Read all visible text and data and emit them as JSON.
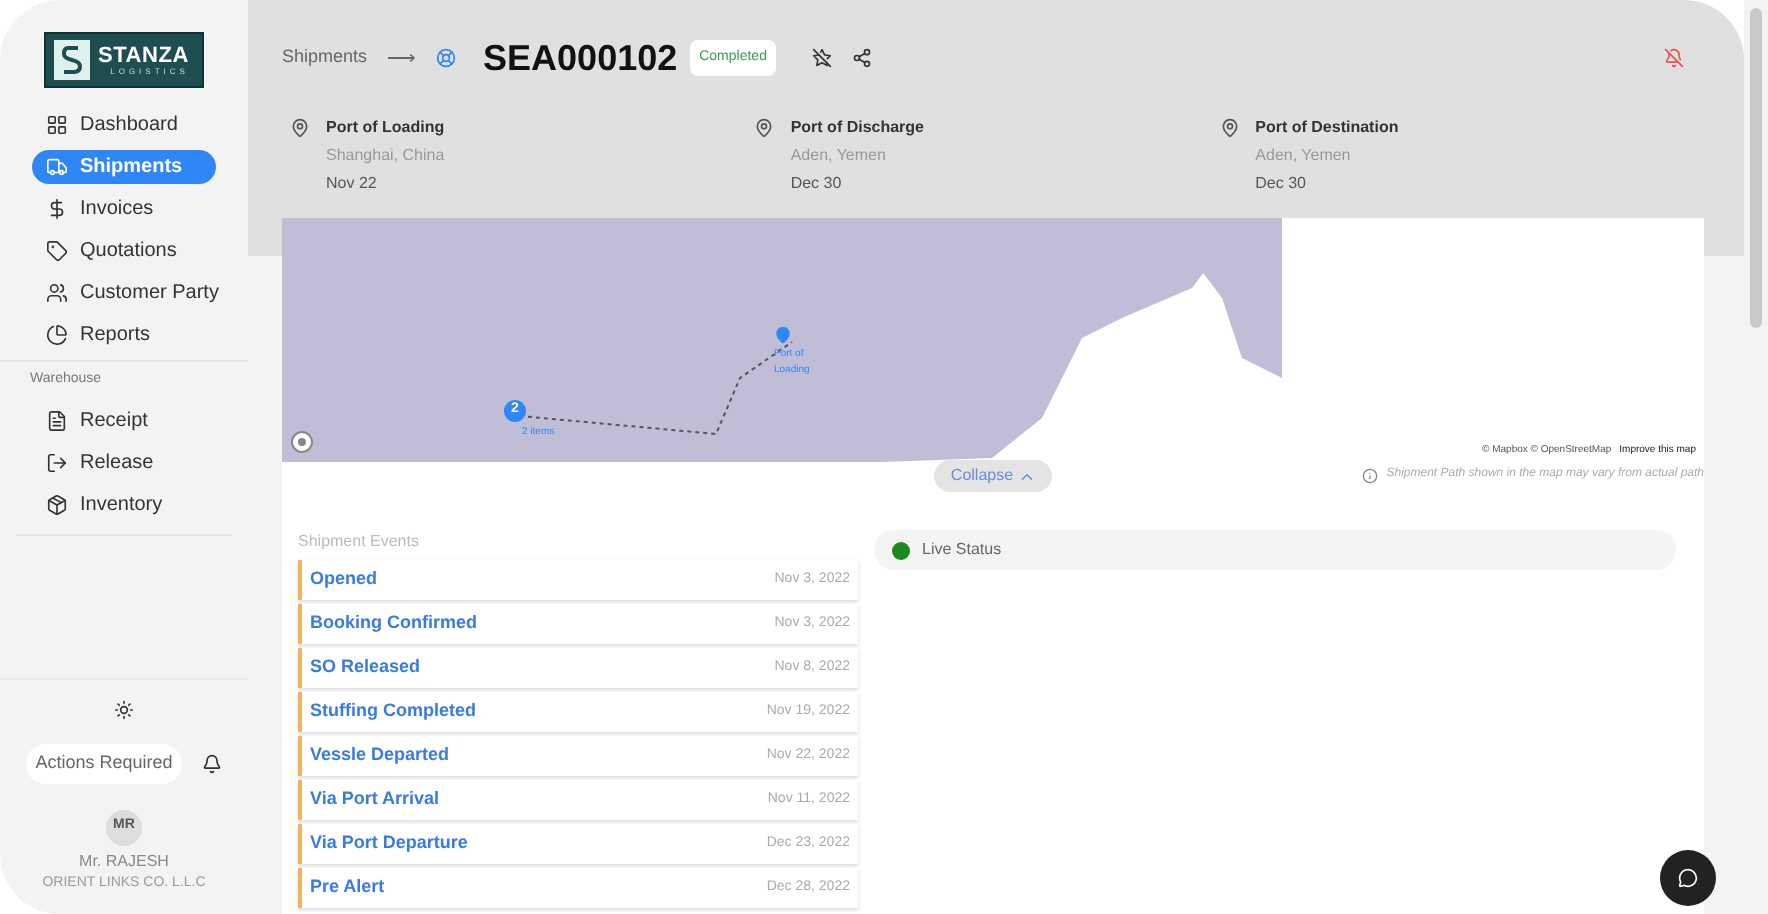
{
  "logo": {
    "name": "STANZA",
    "tagline": "LOGISTICS"
  },
  "sidebar": {
    "items": [
      {
        "label": "Dashboard",
        "selected": false
      },
      {
        "label": "Shipments",
        "selected": true
      },
      {
        "label": "Invoices",
        "selected": false
      },
      {
        "label": "Quotations",
        "selected": false
      },
      {
        "label": "Customer Party",
        "selected": false
      },
      {
        "label": "Reports",
        "selected": false
      }
    ],
    "section_title": "Warehouse",
    "warehouse_items": [
      {
        "label": "Receipt",
        "selected": false
      },
      {
        "label": "Release",
        "selected": false
      },
      {
        "label": "Inventory",
        "selected": false
      }
    ],
    "actions_button": "Actions Required",
    "user": {
      "initials": "MR",
      "name": "Mr. RAJESH",
      "company": "ORIENT LINKS CO. L.L.C"
    }
  },
  "breadcrumb": {
    "parent": "Shipments",
    "arrow": "⟶"
  },
  "shipment": {
    "id": "SEA000102",
    "status": "Completed"
  },
  "ports": [
    {
      "label": "Port of Loading",
      "place": "Shanghai, China",
      "date": "Nov 22"
    },
    {
      "label": "Port of Discharge",
      "place": "Aden, Yemen",
      "date": "Dec 30"
    },
    {
      "label": "Port of Destination",
      "place": "Aden, Yemen",
      "date": "Dec 30"
    }
  ],
  "map": {
    "cluster_count": "2",
    "cluster_label": "2 items",
    "marker_label": "Port of Loading",
    "attribution": "© Mapbox © OpenStreetMap",
    "improve_link": "Improve this map"
  },
  "collapse_button": "Collapse",
  "map_note": "Shipment Path shown in the map may vary from actual path",
  "events": {
    "title": "Shipment Events",
    "items": [
      {
        "name": "Opened",
        "date": "Nov 3, 2022"
      },
      {
        "name": "Booking Confirmed",
        "date": "Nov 3, 2022"
      },
      {
        "name": "SO Released",
        "date": "Nov 8, 2022"
      },
      {
        "name": "Stuffing Completed",
        "date": "Nov 19, 2022"
      },
      {
        "name": "Vessle Departed",
        "date": "Nov 22, 2022"
      },
      {
        "name": "Via Port Arrival",
        "date": "Nov 11, 2022"
      },
      {
        "name": "Via Port Departure",
        "date": "Dec 23, 2022"
      },
      {
        "name": "Pre Alert",
        "date": "Dec 28, 2022"
      }
    ]
  },
  "live_status": {
    "label": "Live Status",
    "color": "#1a8a1a"
  }
}
